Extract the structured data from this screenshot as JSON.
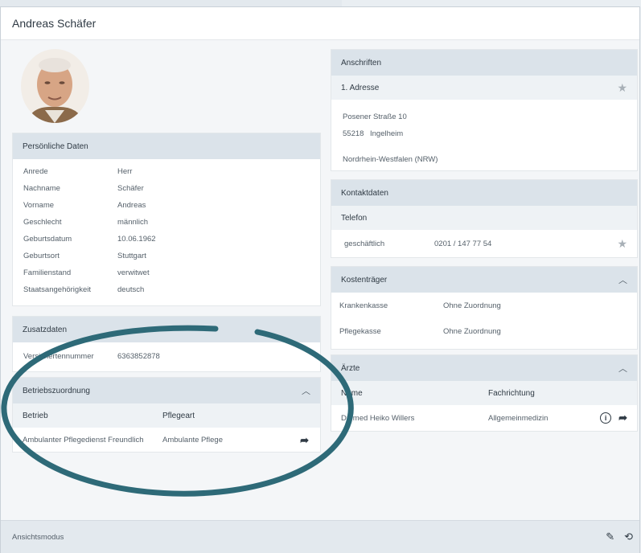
{
  "header": {
    "title": "Andreas Schäfer"
  },
  "personal": {
    "heading": "Persönliche Daten",
    "rows": [
      {
        "label": "Anrede",
        "value": "Herr"
      },
      {
        "label": "Nachname",
        "value": "Schäfer"
      },
      {
        "label": "Vorname",
        "value": "Andreas"
      },
      {
        "label": "Geschlecht",
        "value": "männlich"
      },
      {
        "label": "Geburtsdatum",
        "value": "10.06.1962"
      },
      {
        "label": "Geburtsort",
        "value": "Stuttgart"
      },
      {
        "label": "Familienstand",
        "value": "verwitwet"
      },
      {
        "label": "Staatsangehörigkeit",
        "value": "deutsch"
      }
    ]
  },
  "extra": {
    "heading": "Zusatzdaten",
    "label": "Versichertennummer",
    "value": "6363852878"
  },
  "operations": {
    "heading": "Betriebszuordnung",
    "col_betrieb": "Betrieb",
    "col_pflegeart": "Pflegeart",
    "row_betrieb": "Ambulanter Pflegedienst Freundlich",
    "row_pflegeart": "Ambulante Pflege"
  },
  "addresses": {
    "heading": "Anschriften",
    "sub_heading": "1. Adresse",
    "street": "Posener Straße 10",
    "zip": "55218",
    "city": "Ingelheim",
    "state": "Nordrhein-Westfalen (NRW)"
  },
  "contact": {
    "heading": "Kontaktdaten",
    "sub_heading": "Telefon",
    "type": "geschäftlich",
    "number": "0201 / 147 77 54"
  },
  "payers": {
    "heading": "Kostenträger",
    "rows": [
      {
        "label": "Krankenkasse",
        "value": "Ohne Zuordnung"
      },
      {
        "label": "Pflegekasse",
        "value": "Ohne Zuordnung"
      }
    ]
  },
  "doctors": {
    "heading": "Ärzte",
    "col_name": "Name",
    "col_specialty": "Fachrichtung",
    "row_name": "Dr. med Heiko Willers",
    "row_specialty": "Allgemeinmedizin"
  },
  "footer": {
    "mode": "Ansichtsmodus"
  },
  "colors": {
    "accent_ring": "#2e6a78",
    "header_fill": "#dbe3ea"
  }
}
